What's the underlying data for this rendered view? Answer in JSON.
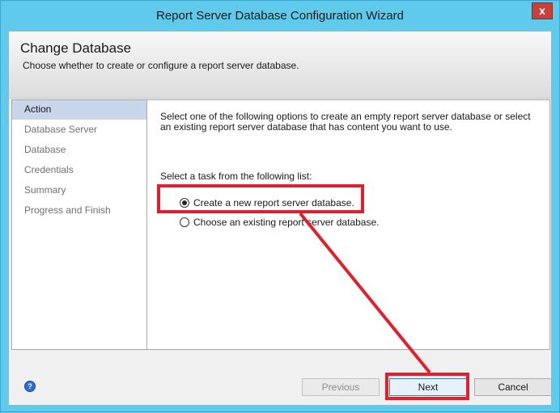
{
  "window": {
    "title": "Report Server Database Configuration Wizard",
    "close_label": "x"
  },
  "header": {
    "title": "Change Database",
    "subtitle": "Choose whether to create or configure a report server database."
  },
  "nav": {
    "items": [
      {
        "label": "Action",
        "active": true
      },
      {
        "label": "Database Server",
        "active": false
      },
      {
        "label": "Database",
        "active": false
      },
      {
        "label": "Credentials",
        "active": false
      },
      {
        "label": "Summary",
        "active": false
      },
      {
        "label": "Progress and Finish",
        "active": false
      }
    ]
  },
  "content": {
    "description": "Select one of the following options to create an empty report server database or select an existing report server database that has content you want to use.",
    "task_label": "Select a task from the following list:",
    "options": [
      {
        "label": "Create a new report server database.",
        "selected": true
      },
      {
        "label": "Choose an existing report server database.",
        "selected": false
      }
    ]
  },
  "footer": {
    "help_icon": "help-icon",
    "help_glyph": "?",
    "previous_label": "Previous",
    "next_label": "Next",
    "cancel_label": "Cancel"
  },
  "annotation": {
    "color": "#e0202e"
  }
}
